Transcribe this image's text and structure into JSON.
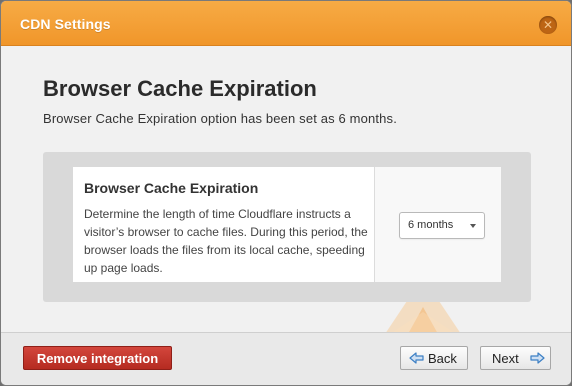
{
  "window": {
    "title": "CDN Settings",
    "close_icon": "close-icon",
    "accent_color": "#f0962a"
  },
  "main": {
    "heading": "Browser Cache Expiration",
    "subtitle": "Browser Cache Expiration option has been set as 6 months."
  },
  "setting_card": {
    "title": "Browser Cache Expiration",
    "description": "Determine the length of time Cloudflare instructs a visitor’s browser to cache files. During this period, the browser loads the files from its local cache, speeding up page loads.",
    "select": {
      "selected_value": "6 months",
      "caret_icon": "caret-down-icon"
    }
  },
  "footer": {
    "remove_label": "Remove integration",
    "back_label": "Back",
    "back_icon": "arrow-left-icon",
    "next_label": "Next",
    "next_icon": "arrow-right-icon",
    "remove_color": "#c0392b",
    "arrow_color": "#3c7fc4"
  }
}
